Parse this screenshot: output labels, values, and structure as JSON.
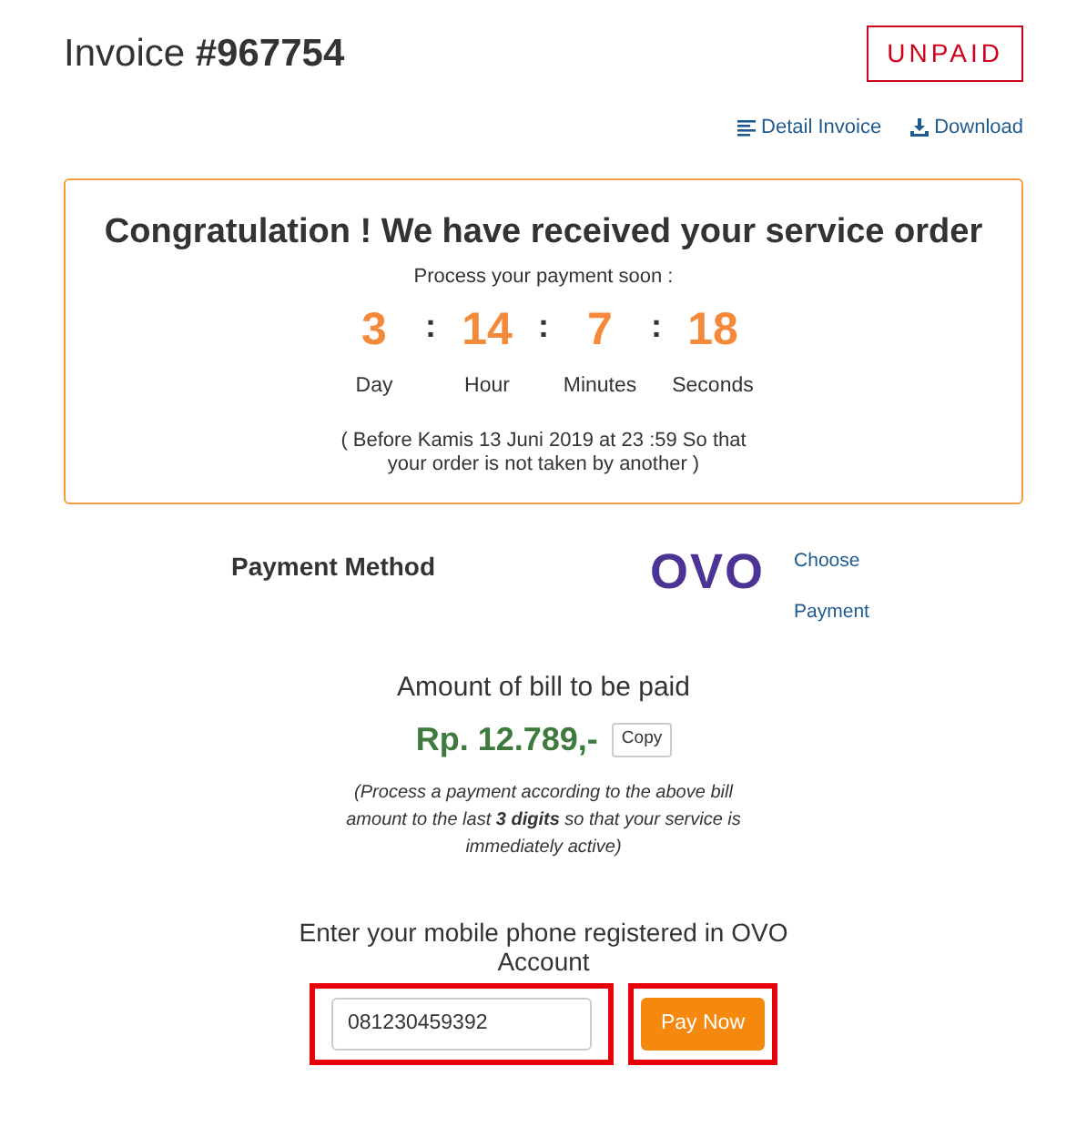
{
  "invoice": {
    "label": "Invoice",
    "number": "#967754",
    "status": "UNPAID"
  },
  "links": [
    {
      "kind": "list",
      "label": "Detail Invoice"
    },
    {
      "kind": "download",
      "label": "Download"
    }
  ],
  "order": {
    "title": "Congratulation ! We have received your service order",
    "subtitle": "Process your payment soon :",
    "countdown": [
      {
        "value": "3",
        "label": "Day"
      },
      {
        "value": "14",
        "label": "Hour"
      },
      {
        "value": "7",
        "label": "Minutes"
      },
      {
        "value": "18",
        "label": "Seconds"
      }
    ],
    "separators": [
      ":",
      ":",
      ":"
    ],
    "deadline": "( Before Kamis 13 Juni 2019 at 23 :59 So that your order is not taken by another )"
  },
  "payment": {
    "label": "Payment Method",
    "logo": "OVO",
    "choose": "Choose Payment"
  },
  "bill": {
    "title": "Amount of bill to be paid",
    "amount": "Rp. 12.789,-",
    "copy": "Copy",
    "note": "(Process a payment according to the above bill amount to the last **3 digits** so that your service is immediately active)"
  },
  "phone": {
    "label": "Enter your mobile phone registered in OVO Account",
    "value": "081230459392",
    "button": "Pay Now"
  }
}
